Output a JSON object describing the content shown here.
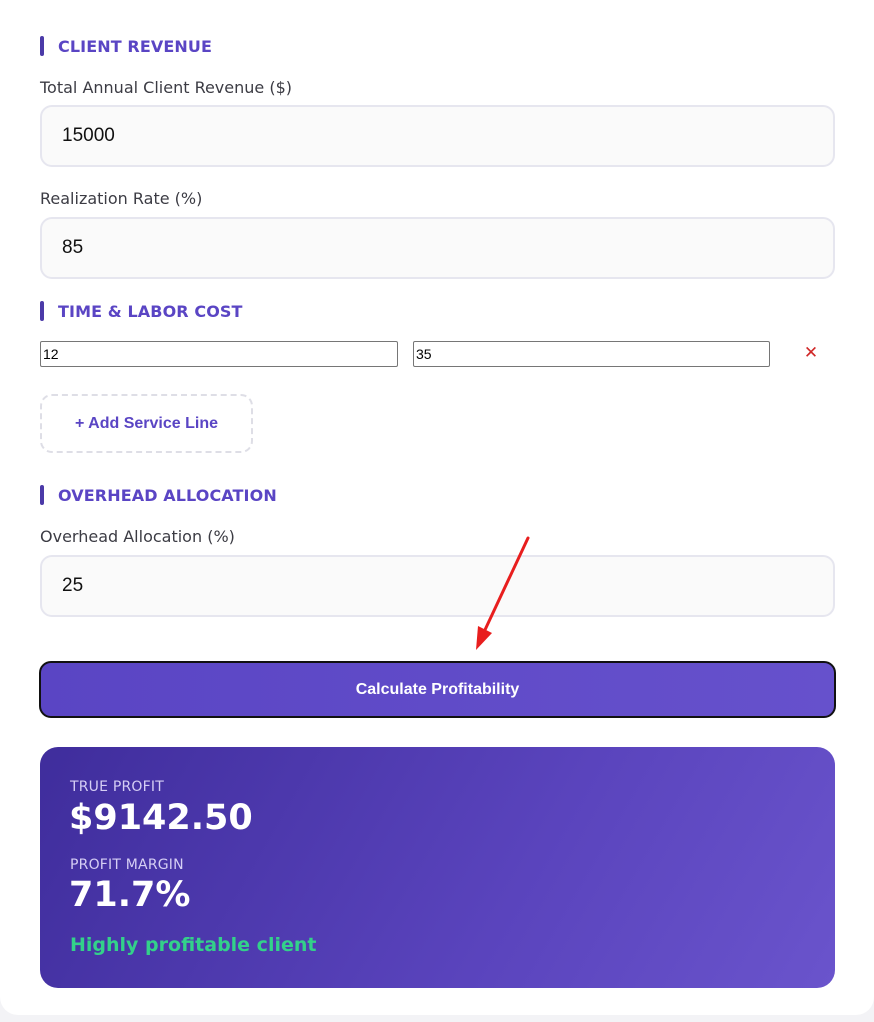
{
  "sections": {
    "client_revenue": "CLIENT REVENUE",
    "time_labor": "TIME & LABOR COST",
    "overhead": "OVERHEAD ALLOCATION"
  },
  "fields": {
    "revenue_label": "Total Annual Client Revenue ($)",
    "revenue_value": "15000",
    "realization_label": "Realization Rate (%)",
    "realization_value": "85",
    "overhead_label": "Overhead Allocation (%)",
    "overhead_value": "25"
  },
  "service_line": {
    "hours": "12",
    "rate": "35",
    "remove": "✕"
  },
  "buttons": {
    "add_service_line": "+ Add Service Line",
    "calculate": "Calculate Profitability"
  },
  "results": {
    "profit_label": "TRUE PROFIT",
    "profit_value": "$9142.50",
    "margin_label": "PROFIT MARGIN",
    "margin_value": "71.7%",
    "status": "Highly profitable client"
  },
  "colors": {
    "accent": "#5a45c4",
    "danger": "#d02727",
    "success": "#33d18a",
    "annotation_arrow": "#e81e1e"
  },
  "icons": {
    "remove": "close-icon",
    "annotation": "red-arrow-icon"
  }
}
